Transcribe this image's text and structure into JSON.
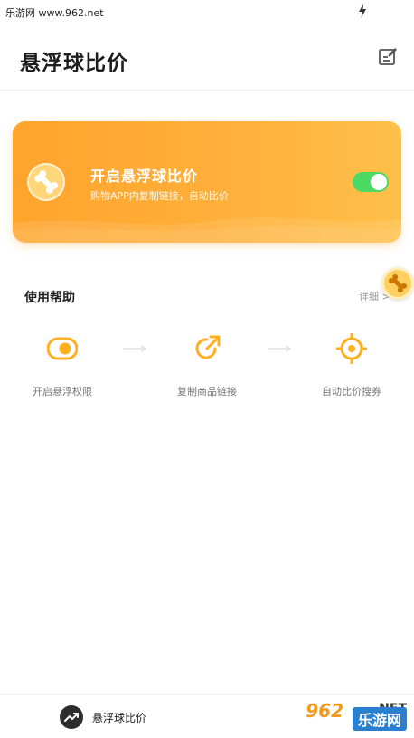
{
  "watermark_top": "乐游网 www.962.net",
  "header": {
    "title": "悬浮球比价"
  },
  "float_card": {
    "title": "开启悬浮球比价",
    "subtitle": "购物APP内复制链接，自动比价",
    "toggle_on": true,
    "toggle_color": "#4cd964",
    "card_color": "#ffa42c"
  },
  "help": {
    "title": "使用帮助",
    "detail_label": "详细 >",
    "steps": [
      {
        "label": "开启悬浮权限",
        "icon": "toggle-icon"
      },
      {
        "label": "复制商品链接",
        "icon": "share-arrow-icon"
      },
      {
        "label": "自动比价搜券",
        "icon": "target-icon"
      }
    ]
  },
  "bottom_nav": {
    "tab_label": "悬浮球比价",
    "tab_icon": "trend-icon"
  },
  "watermark_bottom": {
    "number": "962",
    "net": ".NET",
    "site": "乐游网"
  },
  "accent_color": "#ffb020"
}
